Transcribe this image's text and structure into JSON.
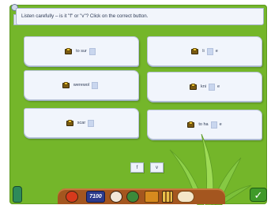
{
  "instruction": {
    "text": "Listen carefully – is it \"f\" or \"v\"? Click on the correct button."
  },
  "cards": [
    {
      "before": "to sur",
      "after": ""
    },
    {
      "before": "li",
      "after": "e"
    },
    {
      "before": "werewol",
      "after": ""
    },
    {
      "before": "kni",
      "after": "e"
    },
    {
      "before": "scar",
      "after": ""
    },
    {
      "before": "to ha",
      "after": "e"
    }
  ],
  "answer_buttons": {
    "f": "f",
    "v": "v"
  },
  "taskbar": {
    "clock": "7100"
  },
  "colors": {
    "board": "#74b62a",
    "card": "#f1f5fc",
    "blank": "#c9d6ee",
    "taskbar": "#a4561f",
    "check": "#3f9a2a"
  },
  "icons": {
    "speaker": "speaker-icon",
    "check": "check-icon",
    "bottle": "bottle-icon"
  }
}
